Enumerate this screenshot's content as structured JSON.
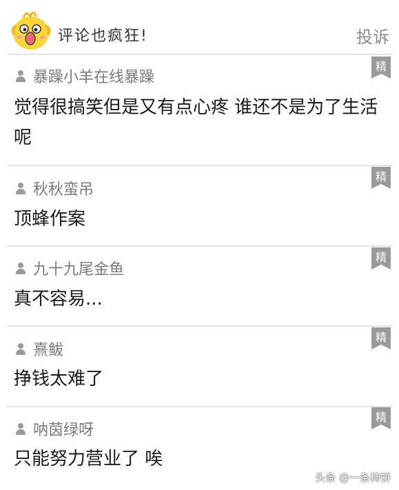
{
  "header": {
    "title": "评论也疯狂!",
    "report_label": "投诉"
  },
  "badge_label": "精",
  "comments": [
    {
      "user": "暴躁小羊在线暴躁",
      "text": "觉得很搞笑但是又有点心疼 谁还不是为了生活呢"
    },
    {
      "user": "秋秋蛮吊",
      "text": "顶蜂作案"
    },
    {
      "user": "九十九尾金鱼",
      "text": "真不容易..."
    },
    {
      "user": "熹鲅",
      "text": "挣钱太难了"
    },
    {
      "user": "呐茵绿呀",
      "text": "只能努力营业了 唉"
    }
  ],
  "watermark": "头条 @一条柿饼",
  "colors": {
    "mascot_yellow": "#f7d635",
    "badge_gray": "#9a9a9a",
    "divider": "#e3e3e3"
  }
}
